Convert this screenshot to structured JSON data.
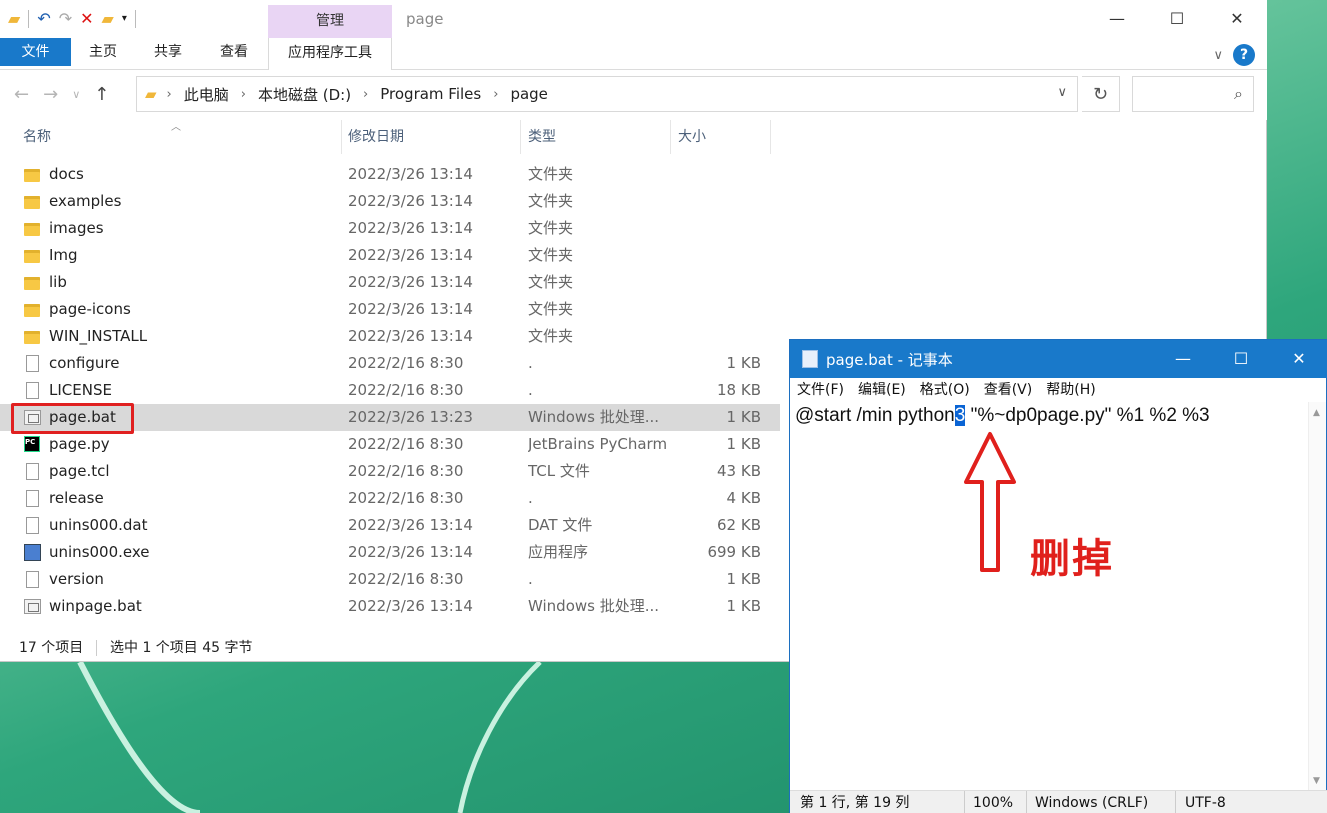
{
  "explorer": {
    "title": "page",
    "context_tab": "管理",
    "quick_access": [
      "folder-icon",
      "undo-icon",
      "redo-icon",
      "delete-icon",
      "new-folder-icon",
      "customize-dropdown-icon"
    ],
    "window_buttons": [
      "—",
      "☐",
      "✕"
    ],
    "ribbon_tabs": {
      "file": "文件",
      "home": "主页",
      "share": "共享",
      "view": "查看",
      "app_tools": "应用程序工具"
    },
    "breadcrumbs": [
      "此电脑",
      "本地磁盘 (D:)",
      "Program Files",
      "page"
    ],
    "search_placeholder": "",
    "columns": {
      "name": "名称",
      "date": "修改日期",
      "type": "类型",
      "size": "大小"
    },
    "files": [
      {
        "name": "docs",
        "date": "2022/3/26 13:14",
        "type": "文件夹",
        "size": "",
        "icon": "folder"
      },
      {
        "name": "examples",
        "date": "2022/3/26 13:14",
        "type": "文件夹",
        "size": "",
        "icon": "folder"
      },
      {
        "name": "images",
        "date": "2022/3/26 13:14",
        "type": "文件夹",
        "size": "",
        "icon": "folder"
      },
      {
        "name": "Img",
        "date": "2022/3/26 13:14",
        "type": "文件夹",
        "size": "",
        "icon": "folder"
      },
      {
        "name": "lib",
        "date": "2022/3/26 13:14",
        "type": "文件夹",
        "size": "",
        "icon": "folder"
      },
      {
        "name": "page-icons",
        "date": "2022/3/26 13:14",
        "type": "文件夹",
        "size": "",
        "icon": "folder"
      },
      {
        "name": "WIN_INSTALL",
        "date": "2022/3/26 13:14",
        "type": "文件夹",
        "size": "",
        "icon": "folder"
      },
      {
        "name": "configure",
        "date": "2022/2/16 8:30",
        "type": ".",
        "size": "1 KB",
        "icon": "doc"
      },
      {
        "name": "LICENSE",
        "date": "2022/2/16 8:30",
        "type": ".",
        "size": "18 KB",
        "icon": "doc"
      },
      {
        "name": "page.bat",
        "date": "2022/3/26 13:23",
        "type": "Windows 批处理...",
        "size": "1 KB",
        "icon": "bat",
        "selected": true
      },
      {
        "name": "page.py",
        "date": "2022/2/16 8:30",
        "type": "JetBrains PyCharm",
        "size": "1 KB",
        "icon": "pyc"
      },
      {
        "name": "page.tcl",
        "date": "2022/2/16 8:30",
        "type": "TCL 文件",
        "size": "43 KB",
        "icon": "doc"
      },
      {
        "name": "release",
        "date": "2022/2/16 8:30",
        "type": ".",
        "size": "4 KB",
        "icon": "doc"
      },
      {
        "name": "unins000.dat",
        "date": "2022/3/26 13:14",
        "type": "DAT 文件",
        "size": "62 KB",
        "icon": "doc"
      },
      {
        "name": "unins000.exe",
        "date": "2022/3/26 13:14",
        "type": "应用程序",
        "size": "699 KB",
        "icon": "exe"
      },
      {
        "name": "version",
        "date": "2022/2/16 8:30",
        "type": ".",
        "size": "1 KB",
        "icon": "doc"
      },
      {
        "name": "winpage.bat",
        "date": "2022/3/26 13:14",
        "type": "Windows 批处理...",
        "size": "1 KB",
        "icon": "bat"
      }
    ],
    "status": {
      "count": "17 个项目",
      "selection": "选中 1 个项目  45 字节"
    }
  },
  "notepad": {
    "title": "page.bat - 记事本",
    "menu": [
      "文件(F)",
      "编辑(E)",
      "格式(O)",
      "查看(V)",
      "帮助(H)"
    ],
    "content_before": "@start /min python",
    "content_selected": "3",
    "content_after": " \"%~dp0page.py\" %1 %2 %3",
    "status": {
      "position": "第 1 行, 第 19 列",
      "zoom": "100%",
      "line_ending": "Windows (CRLF)",
      "encoding": "UTF-8"
    }
  },
  "annotation": {
    "text": "删掉",
    "color": "#e0201c"
  },
  "colors": {
    "accent": "#1979ca",
    "context_tab": "#e9d5f4",
    "selection_row": "#d9d9d9"
  }
}
